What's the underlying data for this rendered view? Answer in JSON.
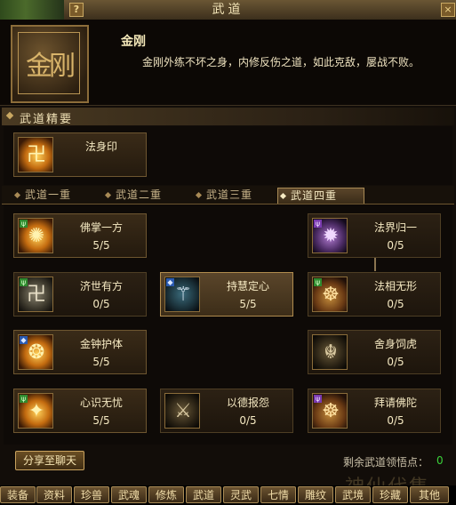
{
  "window": {
    "title": "武道",
    "help": "?",
    "close": "×"
  },
  "header": {
    "emblem_text": "金刚",
    "name": "金刚",
    "description": "金刚外练不坏之身，内修反伤之道，如此克敌，屡战不败。"
  },
  "section": {
    "title": "武道精要"
  },
  "essence": {
    "name": "法身印"
  },
  "tabs": [
    {
      "label": "武道一重"
    },
    {
      "label": "武道二重"
    },
    {
      "label": "武道三重"
    },
    {
      "label": "武道四重"
    }
  ],
  "skills": [
    {
      "name": "佛掌一方",
      "level": "5/5"
    },
    {
      "name": "法界归一",
      "level": "0/5"
    },
    {
      "name": "济世有方",
      "level": "0/5"
    },
    {
      "name": "持慧定心",
      "level": "5/5"
    },
    {
      "name": "法相无形",
      "level": "0/5"
    },
    {
      "name": "金钟护体",
      "level": "5/5"
    },
    {
      "name": "舍身饲虎",
      "level": "0/5"
    },
    {
      "name": "心识无忧",
      "level": "5/5"
    },
    {
      "name": "以德报怨",
      "level": "0/5"
    },
    {
      "name": "拜请佛陀",
      "level": "0/5"
    }
  ],
  "footer": {
    "share_button": "分享至聊天",
    "points_label": "剩余武道领悟点：",
    "points_value": "0",
    "watermark": "神仙代售"
  },
  "menu": [
    {
      "label": "装备"
    },
    {
      "label": "资料"
    },
    {
      "label": "珍兽"
    },
    {
      "label": "武魂"
    },
    {
      "label": "修炼"
    },
    {
      "label": "武道"
    },
    {
      "label": "灵武"
    },
    {
      "label": "七情"
    },
    {
      "label": "雕纹"
    },
    {
      "label": "武境"
    },
    {
      "label": "珍藏"
    },
    {
      "label": "其他"
    }
  ]
}
